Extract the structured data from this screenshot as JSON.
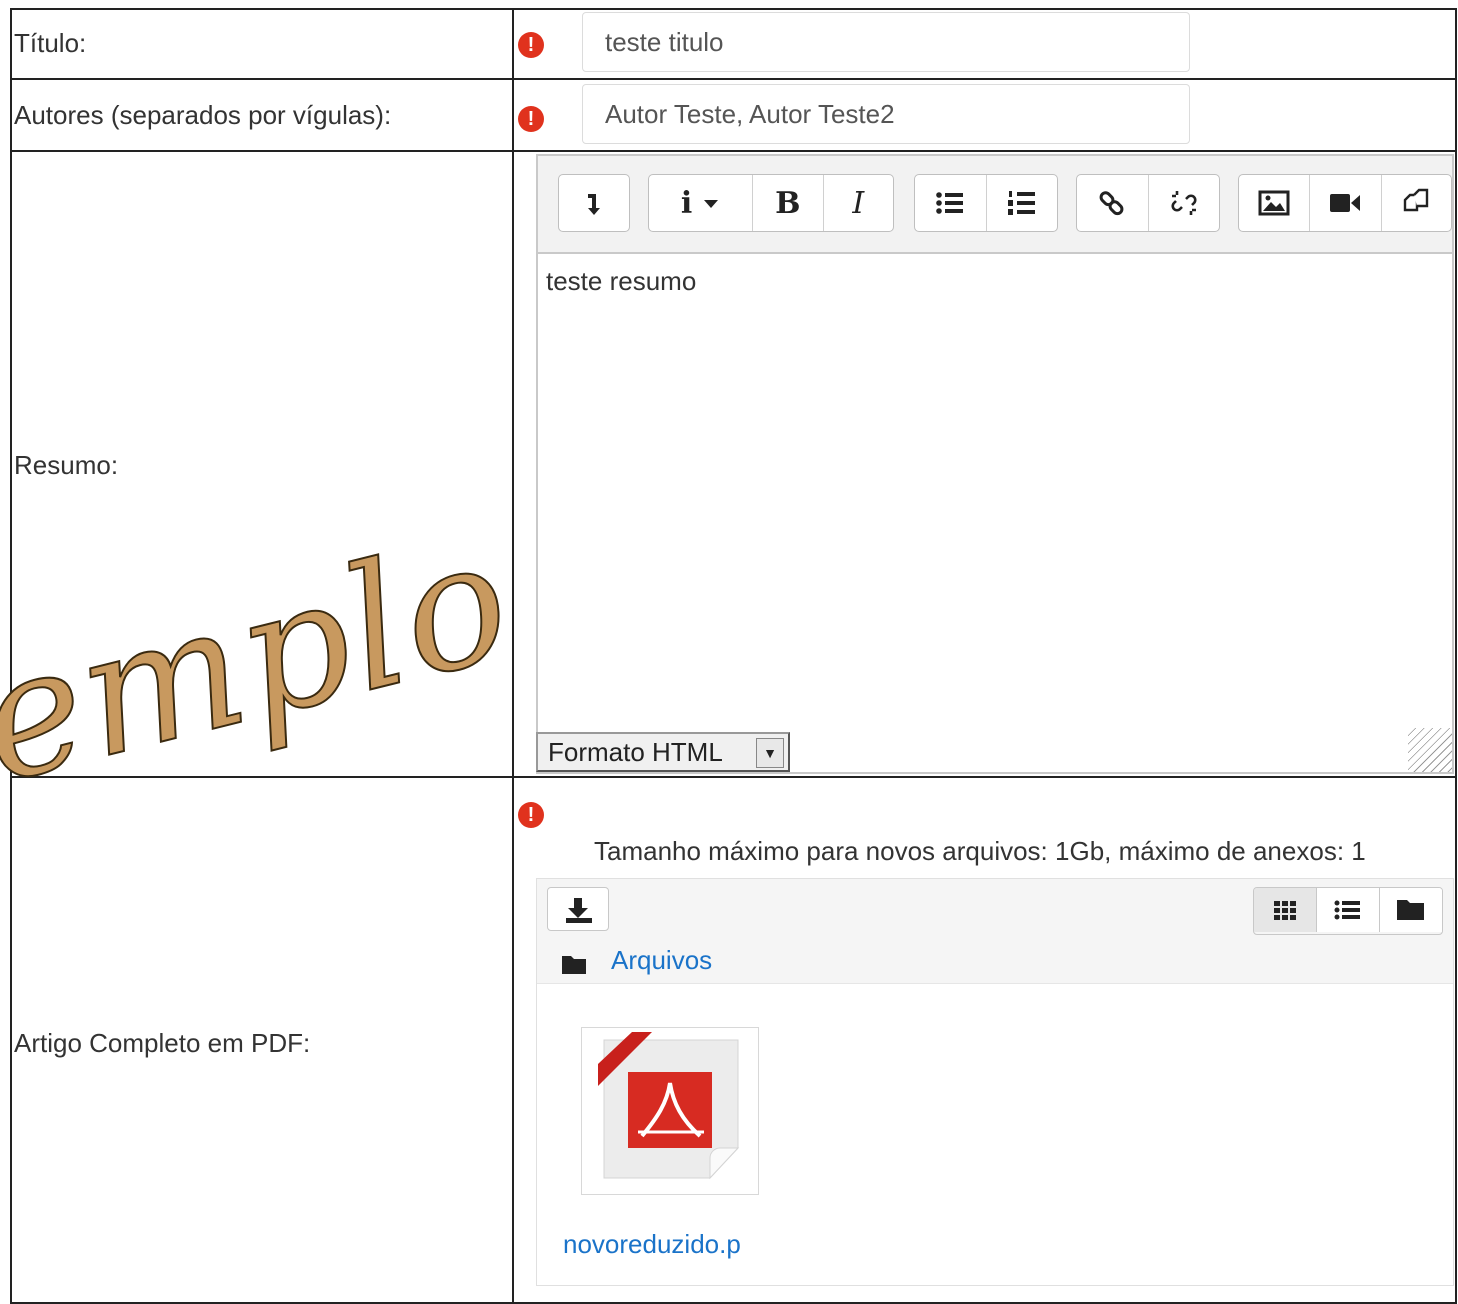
{
  "form": {
    "titulo": {
      "label": "Título:",
      "value": "teste titulo"
    },
    "autores": {
      "label": "Autores (separados por vígulas):",
      "value": "Autor Teste, Autor Teste2"
    },
    "resumo": {
      "label": "Resumo:",
      "content": "teste resumo",
      "format_select": "Formato HTML",
      "toolbar": [
        "expand-icon",
        "info-dropdown",
        "bold",
        "italic",
        "bulleted-list-icon",
        "numbered-list-icon",
        "link-icon",
        "unlink-icon",
        "image-icon",
        "video-icon",
        "manage-files-icon"
      ],
      "info_label": "i",
      "bold_label": "B",
      "italic_label": "I"
    },
    "artigo": {
      "label": "Artigo Completo em PDF:",
      "max_info": "Tamanho máximo para novos arquivos: 1Gb, máximo de anexos: 1",
      "breadcrumb": "Arquivos",
      "file_name": "novoreduzido.p"
    },
    "required_mark": "!"
  },
  "watermark": "emplo",
  "colors": {
    "required": "#e0321d",
    "link": "#1a73c9",
    "watermark": "#c8995f",
    "pdf": "#d72b22"
  }
}
